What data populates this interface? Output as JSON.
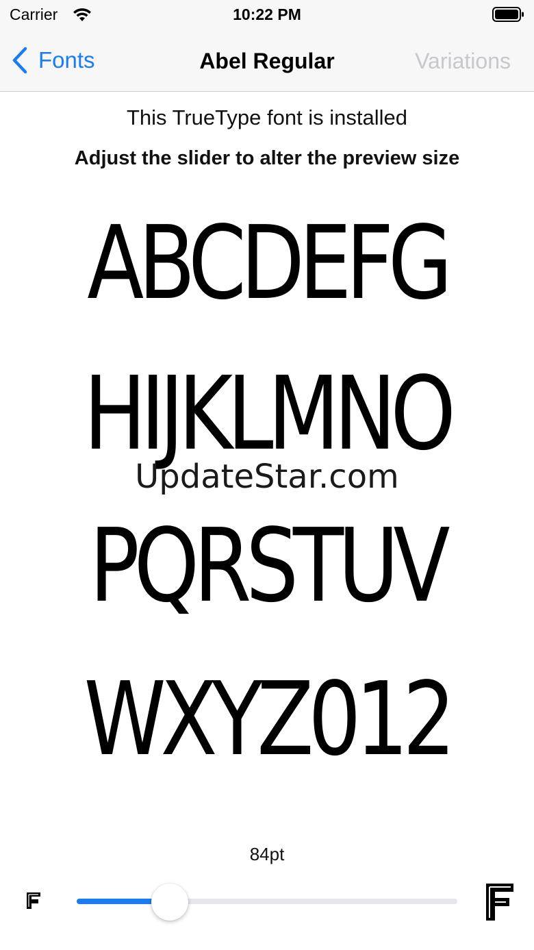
{
  "status_bar": {
    "carrier": "Carrier",
    "time": "10:22 PM",
    "wifi_icon": "wifi-icon",
    "battery_icon": "battery-full-icon"
  },
  "nav": {
    "back_label": "Fonts",
    "back_icon": "chevron-left-icon",
    "title": "Abel Regular",
    "right_button": "Variations",
    "accent_color": "#1a7cf5",
    "disabled_color": "#c7c7cc"
  },
  "content": {
    "installed_text": "This TrueType font is installed",
    "instructions": "Adjust the slider to alter the preview size",
    "preview_lines": [
      "ABCDEFG",
      "HIJKLMNO",
      "PQRSTUV",
      "WXYZ012"
    ],
    "watermark": "UpdateStar.com"
  },
  "slider": {
    "size_label": "84pt",
    "value_fraction": 0.245,
    "min_icon": "font-small-icon",
    "max_icon": "font-large-icon"
  }
}
